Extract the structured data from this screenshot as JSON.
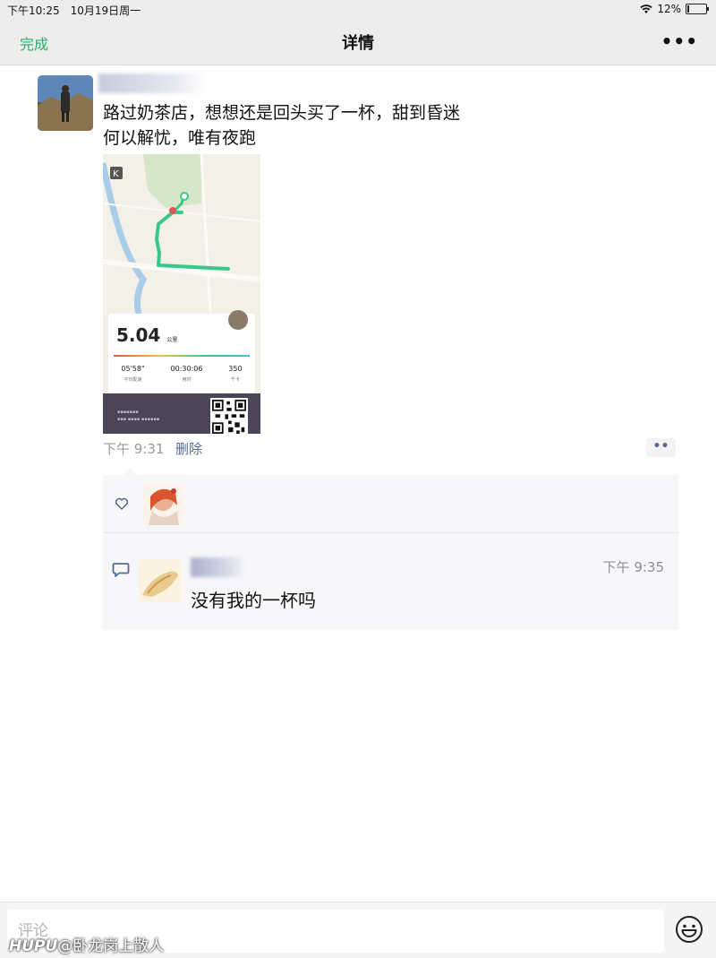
{
  "status_bar": {
    "time": "下午10:25",
    "date": "10月19日周一",
    "battery": "12%",
    "battery_level": 0.12
  },
  "nav": {
    "done_label": "完成",
    "title": "详情",
    "more_label": "•••"
  },
  "post": {
    "text_lines": [
      "路过奶茶店，想想还是回头买了一杯，甜到昏迷",
      "何以解忧，唯有夜跑"
    ],
    "image": {
      "distance": "5.04",
      "distance_unit": "公里",
      "stats": [
        {
          "value": "05'58\"",
          "label": "平均配速"
        },
        {
          "value": "00:30:06",
          "label": "用时"
        },
        {
          "value": "350",
          "label": "千卡"
        }
      ]
    },
    "time": "下午 9:31",
    "delete_label": "删除",
    "action_label": "••"
  },
  "comment": {
    "time": "下午 9:35",
    "text": "没有我的一杯吗"
  },
  "input": {
    "placeholder": "评论"
  },
  "watermark": {
    "logo": "HUPU",
    "text": "@卧龙岗上散人"
  },
  "colors": {
    "accent_green": "#2aae67",
    "link_blue": "#566b94",
    "route_green": "#38c98a"
  }
}
